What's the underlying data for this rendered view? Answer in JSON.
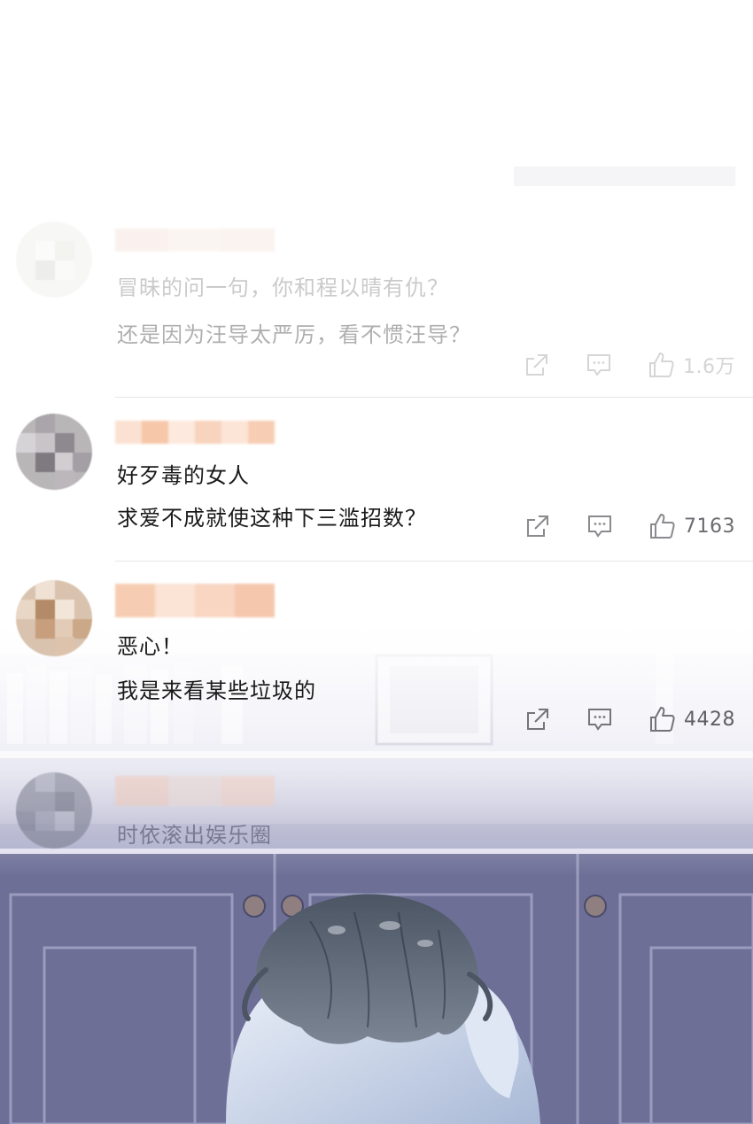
{
  "comments": [
    {
      "lines": [
        "冒昧的问一句，你和程以晴有仇？",
        "还是因为汪导太严厉，看不惯汪导？"
      ],
      "likes": "1.6万",
      "share_icon": "share-icon",
      "reply_icon": "comment-icon",
      "like_icon": "thumbs-up-icon"
    },
    {
      "lines": [
        "好歹毒的女人",
        "求爱不成就使这种下三滥招数？"
      ],
      "likes": "7163",
      "share_icon": "share-icon",
      "reply_icon": "comment-icon",
      "like_icon": "thumbs-up-icon"
    },
    {
      "lines": [
        "恶心！",
        "我是来看某些垃圾的"
      ],
      "likes": "4428",
      "share_icon": "share-icon",
      "reply_icon": "comment-icon",
      "like_icon": "thumbs-up-icon"
    },
    {
      "lines": [
        "时依滚出娱乐圈"
      ]
    }
  ],
  "colors": {
    "text": "#1a1a1a",
    "icon": "#8a8a8f",
    "divider": "#e6e6ea",
    "scene_wall": "#b8b8d4",
    "scene_cabinet": "#6e6f97"
  }
}
